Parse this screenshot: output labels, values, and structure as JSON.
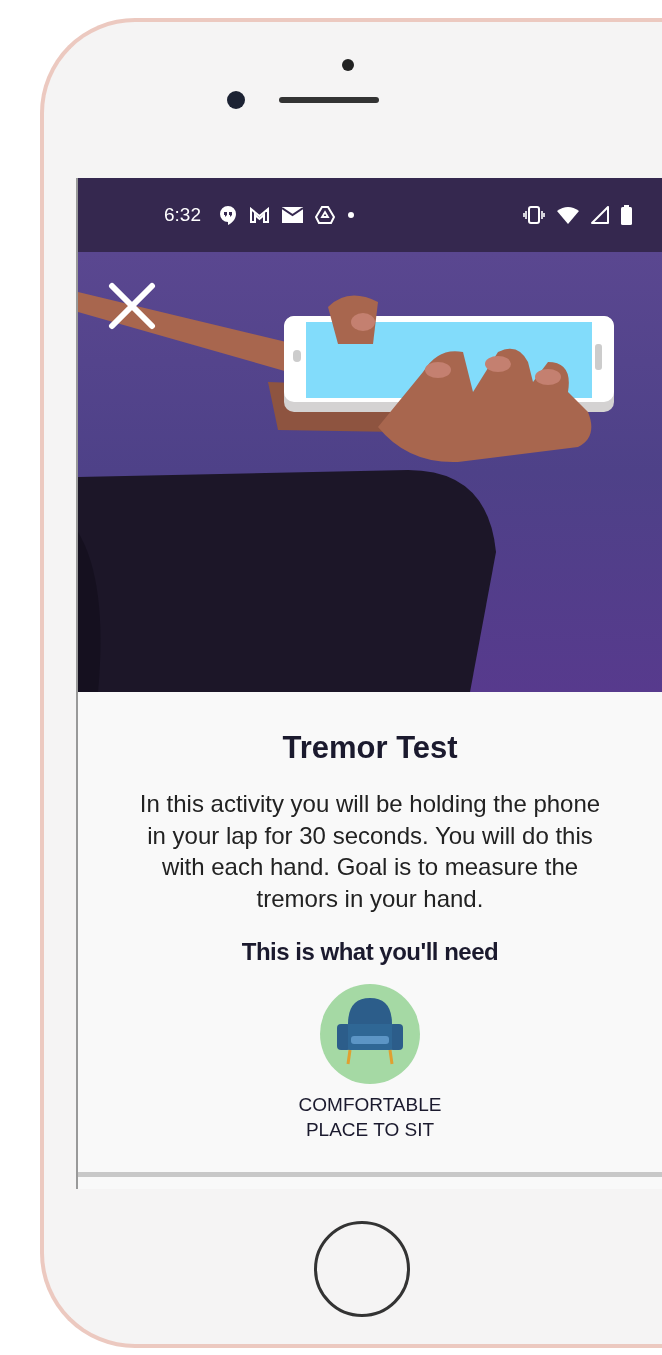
{
  "status_bar": {
    "time": "6:32"
  },
  "activity": {
    "title": "Tremor Test",
    "description": "In this activity you will be holding the phone in your lap for 30 seconds. You will do this with each hand. Goal is to measure the tremors in your hand.",
    "needs_heading": "This is what you'll need",
    "needs": [
      {
        "kind": "chair",
        "label": "COMFORTABLE PLACE TO SIT"
      }
    ]
  }
}
